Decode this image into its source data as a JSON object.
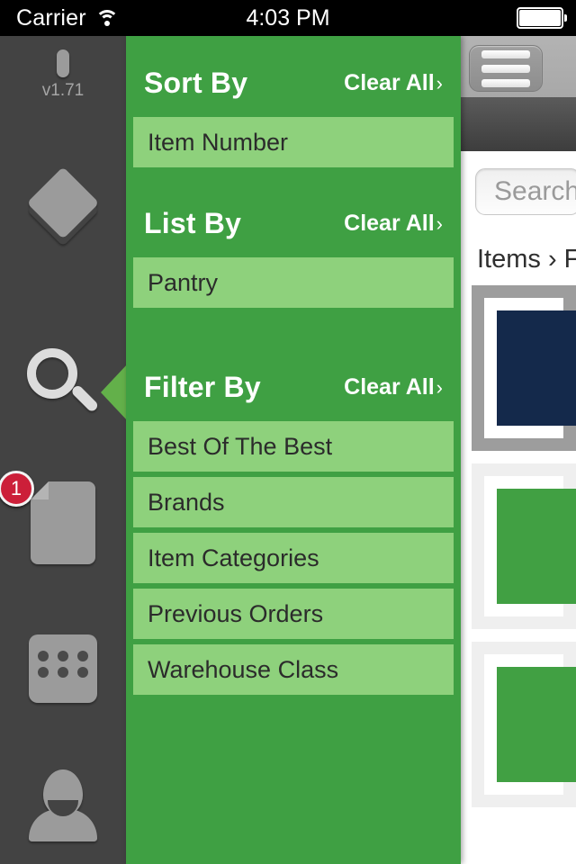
{
  "status_bar": {
    "carrier": "Carrier",
    "time": "4:03 PM",
    "wifi_icon": "wifi-icon",
    "battery_icon": "battery-icon"
  },
  "sidebar": {
    "background_color": "#434343",
    "version": "v1.71",
    "items": [
      {
        "id": "device",
        "icon": "device-icon",
        "label": "v1.71",
        "active": false
      },
      {
        "id": "mail",
        "icon": "envelope-icon",
        "label": "",
        "active": false
      },
      {
        "id": "search",
        "icon": "magnifier-icon",
        "label": "",
        "active": true
      },
      {
        "id": "documents",
        "icon": "document-icon",
        "label": "",
        "active": false,
        "badge": "1"
      },
      {
        "id": "calculator",
        "icon": "calculator-icon",
        "label": "",
        "active": false
      },
      {
        "id": "account",
        "icon": "person-icon",
        "label": "",
        "active": false
      }
    ],
    "badge_color": "#cc1f39"
  },
  "facet_panel": {
    "header_color": "#3fa043",
    "row_color": "#8ed17c",
    "clear_all_label": "Clear All",
    "chevron": "›",
    "sections": [
      {
        "id": "sort-by",
        "title": "Sort By",
        "clear_label": "Clear All",
        "rows": [
          "Item Number"
        ]
      },
      {
        "id": "list-by",
        "title": "List By",
        "clear_label": "Clear All",
        "rows": [
          "Pantry"
        ]
      },
      {
        "id": "filter-by",
        "title": "Filter By",
        "clear_label": "Clear All",
        "rows": [
          "Best Of The Best",
          "Brands",
          "Item Categories",
          "Previous Orders",
          "Warehouse Class"
        ]
      }
    ]
  },
  "content": {
    "menu_icon": "hamburger-icon",
    "search": {
      "placeholder": "Search",
      "value": ""
    },
    "breadcrumb": "Items › Fo",
    "cards": [
      {
        "id": "card-1",
        "thumb_color": "#14294b"
      },
      {
        "id": "card-2",
        "thumb_color": "#41a043"
      },
      {
        "id": "card-3",
        "thumb_color": "#41a043"
      }
    ]
  }
}
